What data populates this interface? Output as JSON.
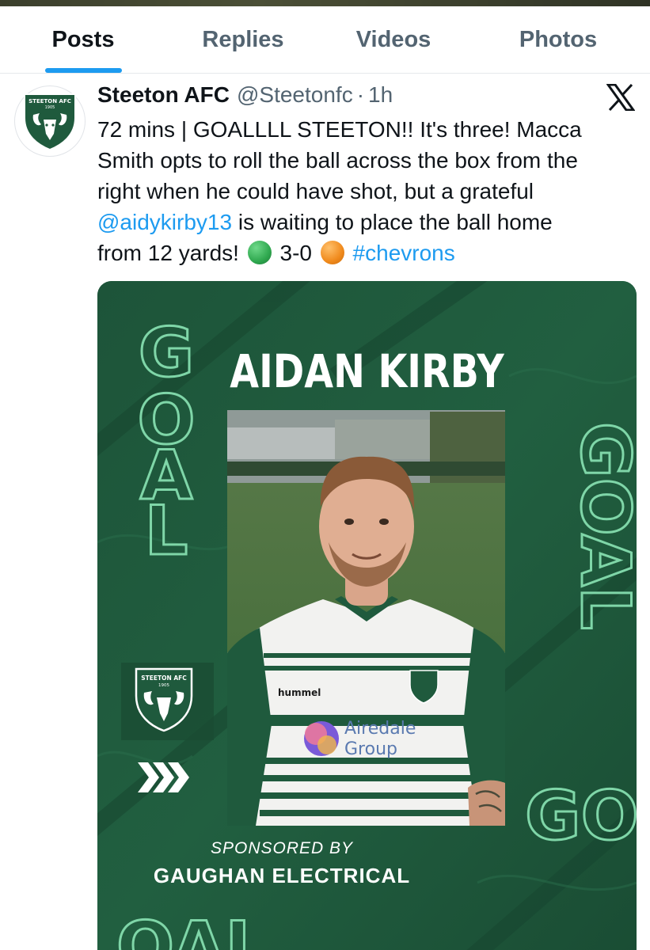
{
  "tabs": [
    {
      "label": "Posts",
      "active": true
    },
    {
      "label": "Replies",
      "active": false
    },
    {
      "label": "Videos",
      "active": false
    },
    {
      "label": "Photos",
      "active": false
    }
  ],
  "post": {
    "author_name": "Steeton AFC",
    "handle": "@Steetonfc",
    "separator": "·",
    "time": "1h",
    "platform_icon": "x-logo-icon",
    "text_lines": [
      "72 mins | GOALLLL STEETON!! It's three! Macca",
      "Smith opts to roll the ball across the box from the",
      "right when he could have shot, but a grateful"
    ],
    "mention": "@aidykirby13",
    "line4_rest": " is waiting to place the ball home",
    "line5_start": "from 12 yards! ",
    "score": " 3-0 ",
    "hashtag": "#chevrons",
    "emoji_colors": {
      "green": "#2fa84f",
      "orange": "#f08a1c"
    }
  },
  "graphic": {
    "background_color": "#1f5a3d",
    "accent_color": "#7fd6a8",
    "goal_text": "GOAL",
    "goal_bottom_fragment": "GO",
    "goal_footer_fragment": "OAL",
    "player_name": "AIDAN KIRBY",
    "crest_text": "STEETON AFC",
    "crest_year": "1905",
    "shirt_brand": "hummel",
    "shirt_sponsor_1": "Airedale",
    "shirt_sponsor_2": "Group",
    "sponsored_by_label": "SPONSORED BY",
    "sponsor_name": "GAUGHAN ELECTRICAL"
  }
}
